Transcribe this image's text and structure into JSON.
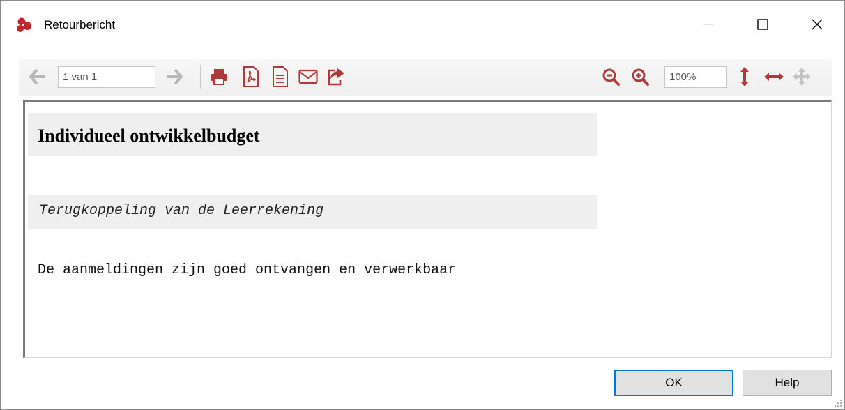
{
  "window": {
    "title": "Retourbericht",
    "app_icon": "app-logo-icon"
  },
  "titlebar_controls": {
    "minimize_icon": "minimize-icon",
    "maximize_icon": "maximize-icon",
    "close_icon": "close-icon"
  },
  "toolbar": {
    "page_value": "1 van 1",
    "zoom_value": "100%",
    "icons": [
      "arrow-left-icon",
      "arrow-right-icon",
      "print-icon",
      "pdf-icon",
      "document-icon",
      "email-icon",
      "share-icon",
      "zoom-out-icon",
      "zoom-in-icon",
      "fit-height-icon",
      "fit-width-icon",
      "move-icon"
    ],
    "accent_color": "#b03a3a",
    "disabled_color": "#b8b8b8"
  },
  "report": {
    "heading": "Individueel ontwikkelbudget",
    "subheading": "Terugkoppeling van de Leerrekening",
    "body": "De aanmeldingen zijn goed ontvangen en verwerkbaar"
  },
  "buttons": {
    "ok_label": "OK",
    "help_label": "Help"
  }
}
